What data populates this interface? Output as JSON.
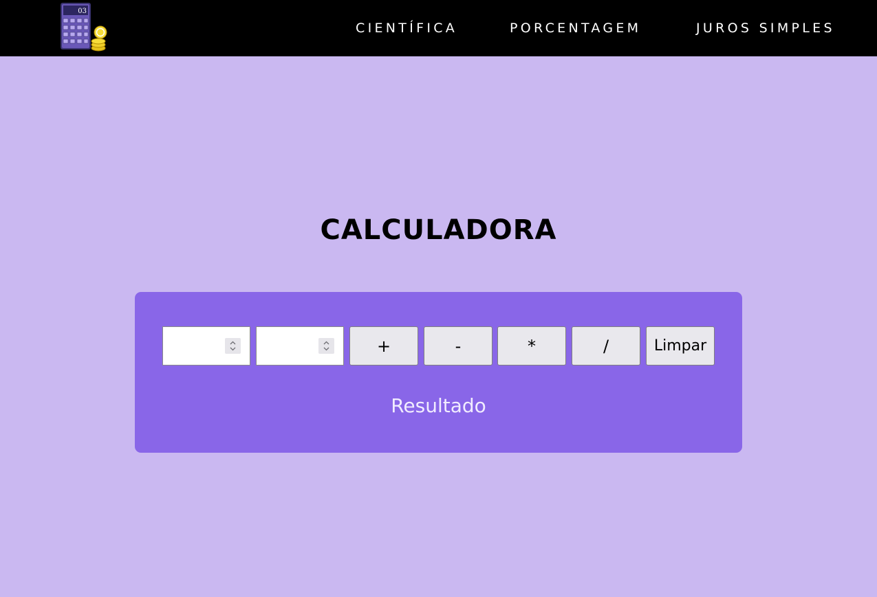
{
  "nav": {
    "logo_icon": "calculator-coins-logo",
    "logo_display": "03",
    "links": [
      "CIENTÍFICA",
      "PORCENTAGEM",
      "JUROS SIMPLES"
    ]
  },
  "main": {
    "title": "CALCULADORA",
    "inputs": [
      {
        "value": "",
        "placeholder": ""
      },
      {
        "value": "",
        "placeholder": ""
      }
    ],
    "operations": [
      "+",
      "-",
      "*",
      "/"
    ],
    "clear_label": "Limpar",
    "result_text": "Resultado"
  },
  "colors": {
    "page_background": "#cab8f1",
    "navbar_background": "#000000",
    "panel_background": "#8966e8",
    "button_background": "#e9e8ed",
    "result_text": "#f1ecff"
  }
}
